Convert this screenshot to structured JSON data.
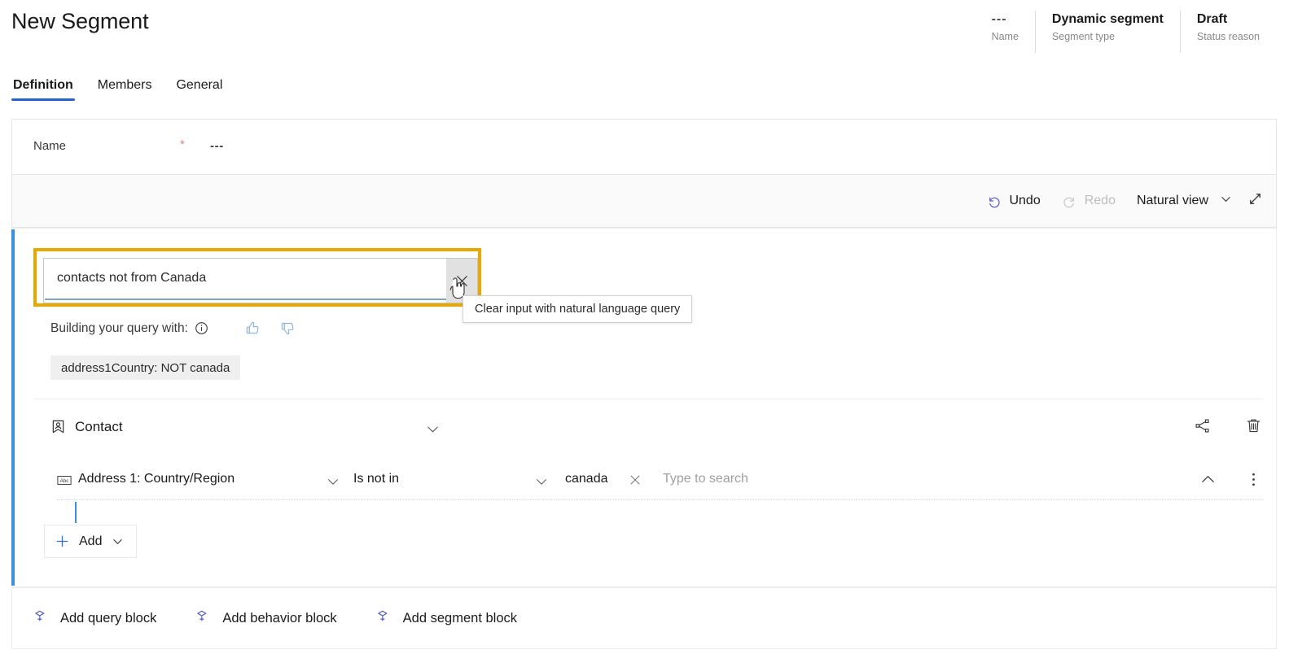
{
  "header": {
    "title": "New Segment",
    "meta": [
      {
        "value": "---",
        "label": "Name"
      },
      {
        "value": "Dynamic segment",
        "label": "Segment type"
      },
      {
        "value": "Draft",
        "label": "Status reason"
      }
    ]
  },
  "tabs": [
    {
      "label": "Definition",
      "active": true
    },
    {
      "label": "Members",
      "active": false
    },
    {
      "label": "General",
      "active": false
    }
  ],
  "name_row": {
    "label": "Name",
    "required_marker": "*",
    "value": "---"
  },
  "toolbar": {
    "undo_label": "Undo",
    "redo_label": "Redo",
    "view_label": "Natural view"
  },
  "query": {
    "nl_input_value": "contacts not from Canada",
    "clear_tooltip": "Clear input with natural language query",
    "building_label": "Building your query with:",
    "token_chip": "address1Country: NOT canada",
    "entity": "Contact",
    "condition": {
      "field": "Address 1: Country/Region",
      "operator": "Is not in",
      "value_chip": "canada",
      "search_placeholder": "Type to search"
    },
    "add_label": "Add"
  },
  "footer": {
    "buttons": [
      {
        "label": "Add query block"
      },
      {
        "label": "Add behavior block"
      },
      {
        "label": "Add segment block"
      }
    ]
  },
  "colors": {
    "accent_blue": "#2564cf",
    "panel_accent": "#3b8fe0",
    "focus_gold": "#e8a800",
    "required_red": "#d9827f",
    "muted": "#8a8886"
  }
}
